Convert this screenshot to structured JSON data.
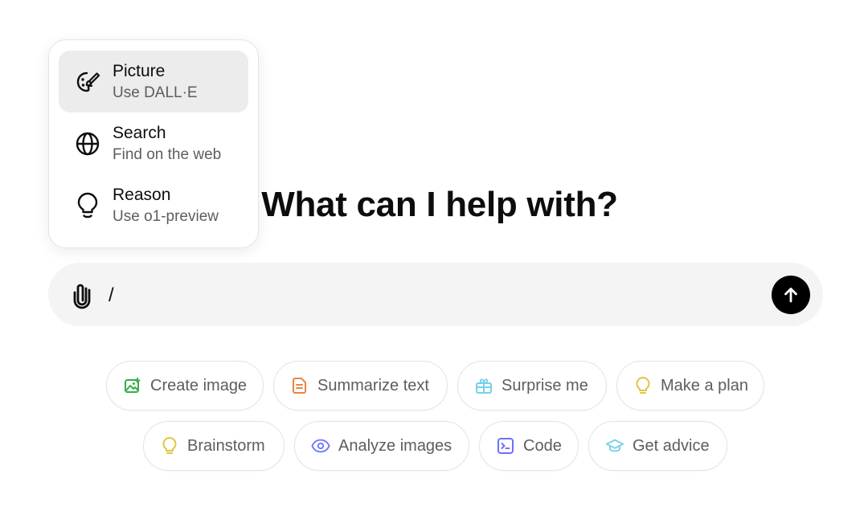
{
  "heading": "What can I help with?",
  "composer": {
    "value": "/",
    "attach_icon": "paperclip-icon",
    "send_icon": "arrow-up-icon"
  },
  "popup_menu": {
    "items": [
      {
        "title": "Picture",
        "subtitle": "Use DALL·E",
        "icon": "palette-icon",
        "active": true
      },
      {
        "title": "Search",
        "subtitle": "Find on the web",
        "icon": "globe-icon",
        "active": false
      },
      {
        "title": "Reason",
        "subtitle": "Use o1-preview",
        "icon": "lightbulb-icon",
        "active": false
      }
    ]
  },
  "suggestions": {
    "row1": [
      {
        "label": "Create image",
        "icon": "image-icon",
        "color": "#35ae47"
      },
      {
        "label": "Summarize text",
        "icon": "document-icon",
        "color": "#ea8444"
      },
      {
        "label": "Surprise me",
        "icon": "gift-icon",
        "color": "#76d0eb"
      },
      {
        "label": "Make a plan",
        "icon": "lightbulb-icon",
        "color": "#e2c541"
      }
    ],
    "row2": [
      {
        "label": "Brainstorm",
        "icon": "lightbulb-icon",
        "color": "#e2c541"
      },
      {
        "label": "Analyze images",
        "icon": "eye-icon",
        "color": "#6c71ff"
      },
      {
        "label": "Code",
        "icon": "terminal-icon",
        "color": "#6c71ff"
      },
      {
        "label": "Get advice",
        "icon": "graduation-cap-icon",
        "color": "#76d0eb"
      }
    ]
  },
  "colors": {
    "composer_bg": "#f4f4f4",
    "send_button": "#000000",
    "menu_active_bg": "#ececec",
    "chip_border": "#e3e3e3"
  }
}
